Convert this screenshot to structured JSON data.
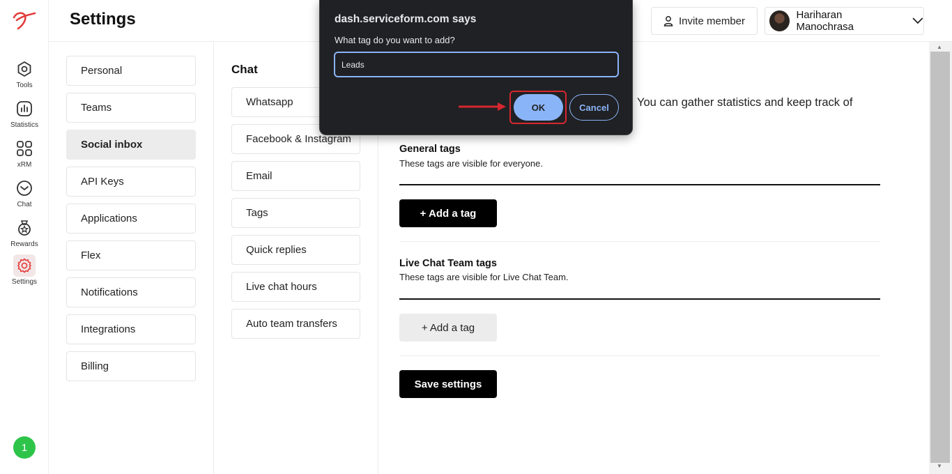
{
  "rail": {
    "items": [
      {
        "label": "Tools",
        "icon": "tools-icon"
      },
      {
        "label": "Statistics",
        "icon": "statistics-icon"
      },
      {
        "label": "xRM",
        "icon": "xrm-icon"
      },
      {
        "label": "Chat",
        "icon": "chat-icon"
      },
      {
        "label": "Rewards",
        "icon": "rewards-icon"
      },
      {
        "label": "Settings",
        "icon": "gear-icon"
      }
    ],
    "badge": "1",
    "brand_color": "#e23b3b",
    "badge_color": "#2ec44a"
  },
  "header": {
    "title": "Settings",
    "invite_label": "Invite member",
    "user_name": "Hariharan Manochrasa"
  },
  "settings_nav": {
    "items": [
      "Personal",
      "Teams",
      "Social inbox",
      "API Keys",
      "Applications",
      "Flex",
      "Notifications",
      "Integrations",
      "Billing"
    ],
    "active": "Social inbox"
  },
  "chat_nav": {
    "title": "Chat",
    "items": [
      "Whatsapp",
      "Facebook & Instagram",
      "Email",
      "Tags",
      "Quick replies",
      "Live chat hours",
      "Auto team transfers"
    ]
  },
  "main": {
    "description_partial": "You can gather statistics and keep track of",
    "general": {
      "title": "General tags",
      "subtitle": "These tags are visible for everyone.",
      "add_label": "+ Add a tag"
    },
    "live_chat": {
      "title": "Live Chat Team tags",
      "subtitle": "These tags are visible for Live Chat Team.",
      "add_label": "+ Add a tag"
    },
    "save_label": "Save settings"
  },
  "dialog": {
    "title": "dash.serviceform.com says",
    "message": "What tag do you want to add?",
    "input_value": "Leads",
    "ok_label": "OK",
    "cancel_label": "Cancel",
    "accent_color": "#8ab4f8",
    "highlight_color": "#d6272e"
  }
}
